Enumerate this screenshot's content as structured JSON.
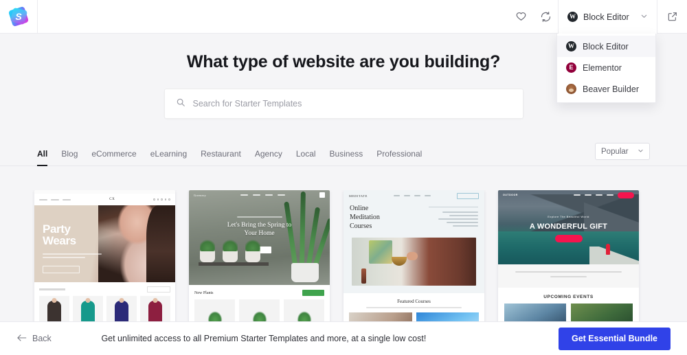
{
  "header": {
    "logo_name": "starter-templates-logo",
    "icons": {
      "favorites": "heart-icon",
      "sync": "refresh-icon",
      "external": "external-link-icon"
    },
    "editor_selector": {
      "selected_label": "Block Editor",
      "chevron": "chevron-down-icon",
      "options": [
        {
          "label": "Block Editor",
          "icon": "wordpress-icon",
          "active": true
        },
        {
          "label": "Elementor",
          "icon": "elementor-icon",
          "active": false
        },
        {
          "label": "Beaver Builder",
          "icon": "beaver-builder-icon",
          "active": false
        }
      ]
    }
  },
  "main": {
    "title": "What type of website are you building?",
    "search": {
      "placeholder": "Search for Starter Templates",
      "value": "",
      "icon": "search-icon"
    },
    "tabs": [
      {
        "label": "All",
        "active": true
      },
      {
        "label": "Blog",
        "active": false
      },
      {
        "label": "eCommerce",
        "active": false
      },
      {
        "label": "eLearning",
        "active": false
      },
      {
        "label": "Restaurant",
        "active": false
      },
      {
        "label": "Agency",
        "active": false
      },
      {
        "label": "Local",
        "active": false
      },
      {
        "label": "Business",
        "active": false
      },
      {
        "label": "Professional",
        "active": false
      }
    ],
    "sort": {
      "selected": "Popular",
      "chevron": "chevron-down-icon"
    },
    "templates": [
      {
        "name": "party-wears",
        "hero_title": "Party Wears",
        "brand": "CX",
        "section_label": ""
      },
      {
        "name": "spring-home-plants",
        "hero_title": "Let's Bring the Spring to\nYour Home",
        "brand": "Greenery",
        "section_label": "New Plants"
      },
      {
        "name": "online-meditation-courses",
        "hero_title": "Online\nMeditation\nCourses",
        "brand": "MEDITATE",
        "section_label": "Featured Courses"
      },
      {
        "name": "outdoor-adventure",
        "hero_title": "A WONDERFUL GIFT",
        "eyebrow": "Explore The Beautiful World",
        "brand": "OUTDOOR",
        "section_label": "UPCOMING EVENTS"
      }
    ]
  },
  "footer": {
    "back_label": "Back",
    "back_icon": "arrow-left-icon",
    "promo_text": "Get unlimited access to all Premium Starter Templates and more, at a single low cost!",
    "cta_label": "Get Essential Bundle"
  },
  "colors": {
    "accent_blue": "#3042e8",
    "page_bg": "#f5f5f7",
    "surface": "#ffffff",
    "elementor": "#92003b",
    "border": "#ebebef"
  }
}
